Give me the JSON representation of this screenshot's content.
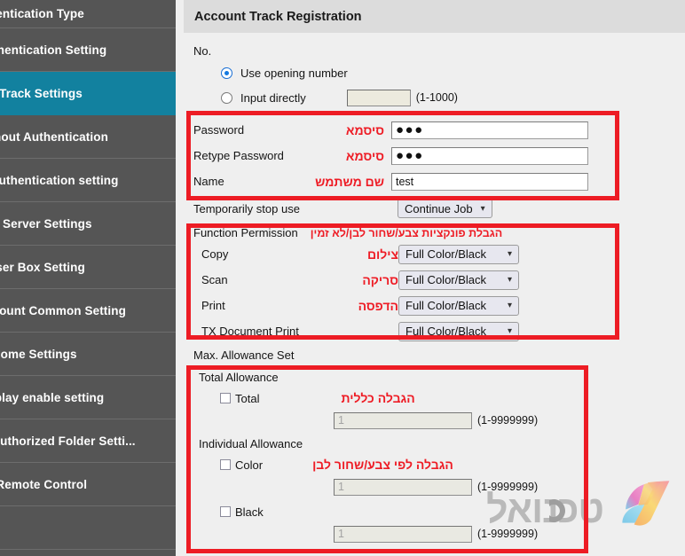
{
  "sidebar": {
    "items": [
      {
        "label": "uthentication Type",
        "active": false
      },
      {
        "label": "Authentication Setting",
        "active": false
      },
      {
        "label": "unt Track Settings",
        "active": true
      },
      {
        "label": "without Authentication",
        "active": false
      },
      {
        "label": "le Authentication setting",
        "active": false
      },
      {
        "label": "rnal Server Settings",
        "active": false
      },
      {
        "label": "c User Box Setting",
        "active": false
      },
      {
        "label": "Account Common Setting",
        "active": false
      },
      {
        "label": "to Home Settings",
        "active": false
      },
      {
        "label": "display enable setting",
        "active": false
      },
      {
        "label": "to Authorized Folder Setti...",
        "active": false
      },
      {
        "label": "ter Remote Control",
        "active": false
      },
      {
        "label": "",
        "active": false
      }
    ]
  },
  "header": {
    "title": "Account Track Registration"
  },
  "no_section": {
    "label": "No.",
    "option_use_opening": "Use opening number",
    "option_input_directly": "Input directly",
    "input_value": "",
    "range_hint": "(1-1000)"
  },
  "credentials": {
    "password": {
      "label": "Password",
      "hebrew": "סיסמא",
      "value": "●●●"
    },
    "retype_password": {
      "label": "Retype Password",
      "hebrew": "סיסמא",
      "value": "●●●"
    },
    "name": {
      "label": "Name",
      "hebrew": "שם משתמש",
      "value": "test"
    }
  },
  "temporarily_stop": {
    "label": "Temporarily stop use",
    "selected": "Continue Job"
  },
  "function_permission": {
    "title": "Function Permission",
    "hebrew_note": "הגבלת פונקציות צבע/שחור לבן/לא זמין",
    "rows": [
      {
        "label": "Copy",
        "hebrew": "צילום",
        "selected": "Full Color/Black"
      },
      {
        "label": "Scan",
        "hebrew": "סריקה",
        "selected": "Full Color/Black"
      },
      {
        "label": "Print",
        "hebrew": "הדפסה",
        "selected": "Full Color/Black"
      },
      {
        "label": "TX Document Print",
        "hebrew": "",
        "selected": "Full Color/Black"
      }
    ]
  },
  "max_allowance": {
    "title": "Max. Allowance Set",
    "total_allowance_label": "Total Allowance",
    "individual_allowance_label": "Individual Allowance",
    "hebrew_total": "הגבלה כללית",
    "hebrew_individual": "הגבלה לפי צבע/שחור לבן",
    "rows": [
      {
        "checkbox_label": "Total",
        "value": "1",
        "range_hint": "(1-9999999)"
      },
      {
        "checkbox_label": "Color",
        "value": "1",
        "range_hint": "(1-9999999)"
      },
      {
        "checkbox_label": "Black",
        "value": "1",
        "range_hint": "(1-9999999)"
      }
    ]
  },
  "watermark": {
    "text": "טכנואל"
  },
  "colors": {
    "sidebar_bg": "#555555",
    "sidebar_active": "#12819f",
    "annotation_red": "#ed1c24",
    "header_bg": "#dcdcdc",
    "page_bg": "#efefef"
  }
}
